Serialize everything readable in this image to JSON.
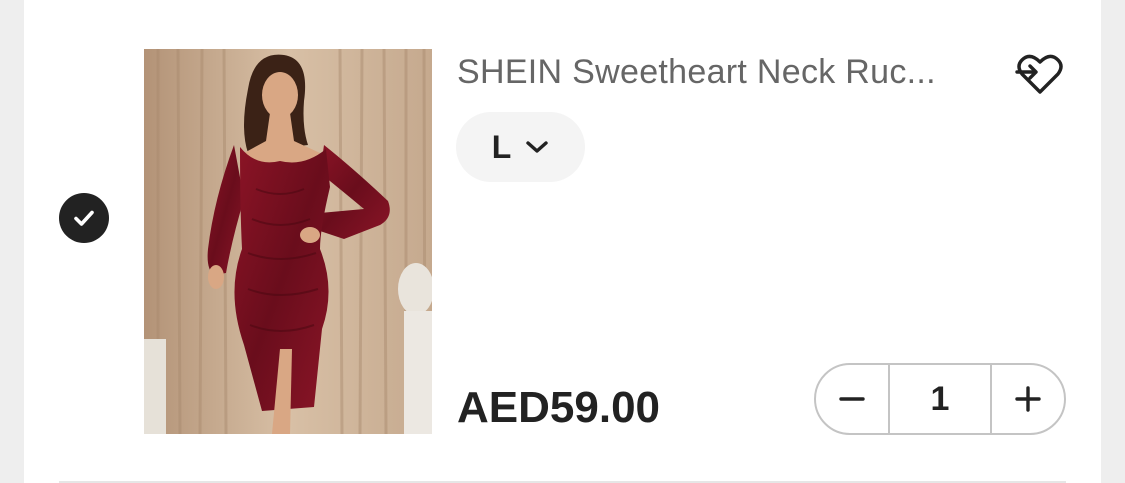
{
  "product": {
    "title": "SHEIN Sweetheart Neck Ruc...",
    "size": "L",
    "price": "AED59.00",
    "quantity": "1",
    "selected": true
  },
  "icons": {
    "check": "check-icon",
    "wishlist": "heart-move-icon",
    "size_dropdown": "chevron-down-icon",
    "decrease": "minus-icon",
    "increase": "plus-icon"
  },
  "colors": {
    "check_bg": "#222222",
    "title": "#666666",
    "price": "#222222",
    "dress": "#7a0f1f",
    "curtain": "#cdb196"
  }
}
